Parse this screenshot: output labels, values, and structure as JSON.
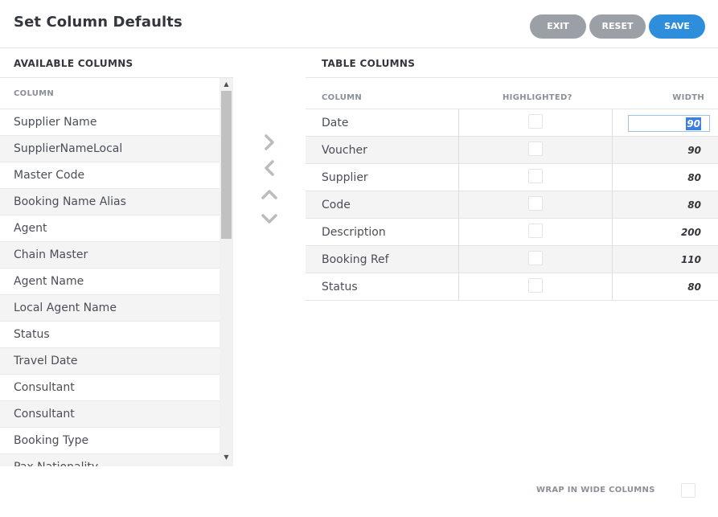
{
  "header": {
    "title": "Set Column Defaults",
    "exit_label": "EXIT",
    "reset_label": "RESET",
    "save_label": "SAVE"
  },
  "available": {
    "section_label": "AVAILABLE COLUMNS",
    "column_header": "COLUMN",
    "items": [
      {
        "label": "Supplier Name"
      },
      {
        "label": "SupplierNameLocal"
      },
      {
        "label": "Master Code"
      },
      {
        "label": "Booking Name Alias"
      },
      {
        "label": "Agent"
      },
      {
        "label": "Chain Master"
      },
      {
        "label": "Agent Name"
      },
      {
        "label": "Local Agent Name"
      },
      {
        "label": "Status"
      },
      {
        "label": "Travel Date"
      },
      {
        "label": "Consultant"
      },
      {
        "label": "Consultant"
      },
      {
        "label": "Booking Type"
      },
      {
        "label": "Pax Nationality"
      }
    ]
  },
  "controls": {
    "move_right_icon": "chevron-right-icon",
    "move_left_icon": "chevron-left-icon",
    "move_up_icon": "chevron-up-icon",
    "move_down_icon": "chevron-down-icon"
  },
  "table": {
    "section_label": "TABLE COLUMNS",
    "headers": {
      "column": "COLUMN",
      "highlighted": "HIGHLIGHTED?",
      "width": "WIDTH"
    },
    "rows": [
      {
        "name": "Date",
        "highlighted": false,
        "width": "90",
        "editing": true
      },
      {
        "name": "Voucher",
        "highlighted": false,
        "width": "90"
      },
      {
        "name": "Supplier",
        "highlighted": false,
        "width": "80"
      },
      {
        "name": "Code",
        "highlighted": false,
        "width": "80"
      },
      {
        "name": "Description",
        "highlighted": false,
        "width": "200"
      },
      {
        "name": "Booking Ref",
        "highlighted": false,
        "width": "110"
      },
      {
        "name": "Status",
        "highlighted": false,
        "width": "80"
      }
    ]
  },
  "footer": {
    "wrap_label": "WRAP IN WIDE COLUMNS",
    "wrap_checked": false
  },
  "colors": {
    "save": "#2f8edb",
    "secondary_button": "#9ba0a6",
    "selection": "#3b7fe0"
  }
}
